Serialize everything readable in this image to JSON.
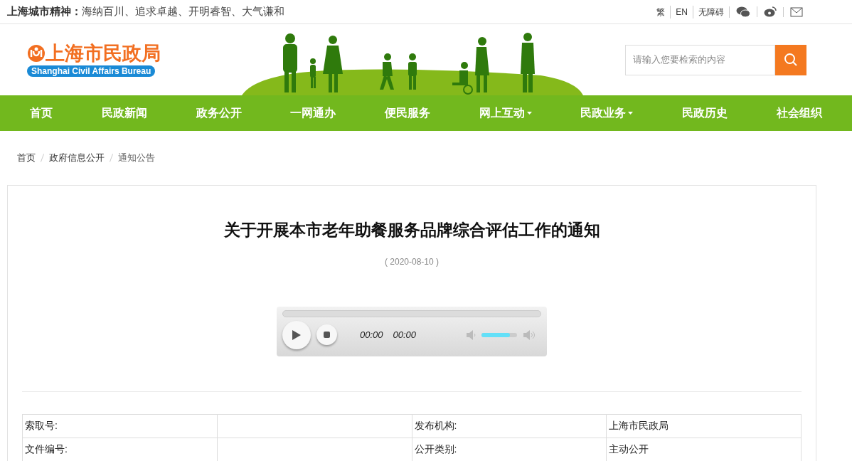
{
  "top_bar": {
    "motto_label": "上海城市精神：",
    "motto": "海纳百川、追求卓越、开明睿智、大气谦和",
    "links": [
      "繁",
      "EN",
      "无障碍"
    ]
  },
  "header": {
    "logo_title": "上海市民政局",
    "logo_subtitle": "Shanghai Civil Affairs Bureau",
    "search": {
      "placeholder": "请输入您要检索的内容"
    }
  },
  "nav": [
    {
      "label": "首页",
      "dropdown": false
    },
    {
      "label": "民政新闻",
      "dropdown": false
    },
    {
      "label": "政务公开",
      "dropdown": false
    },
    {
      "label": "一网通办",
      "dropdown": false
    },
    {
      "label": "便民服务",
      "dropdown": false
    },
    {
      "label": "网上互动",
      "dropdown": true
    },
    {
      "label": "民政业务",
      "dropdown": true
    },
    {
      "label": "民政历史",
      "dropdown": false
    },
    {
      "label": "社会组织",
      "dropdown": false
    }
  ],
  "breadcrumb": [
    "首页",
    "政府信息公开",
    "通知公告"
  ],
  "article": {
    "title": "关于开展本市老年助餐服务品牌综合评估工作的通知",
    "date": "( 2020-08-10 )",
    "player": {
      "current_time": "00:00",
      "duration": "00:00",
      "volume": {
        "level": 0.8
      }
    },
    "info_table": {
      "rows": [
        [
          "索取号:",
          "",
          "发布机构:",
          "上海市民政局"
        ],
        [
          "文件编号:",
          "",
          "公开类别:",
          "主动公开"
        ]
      ]
    }
  }
}
